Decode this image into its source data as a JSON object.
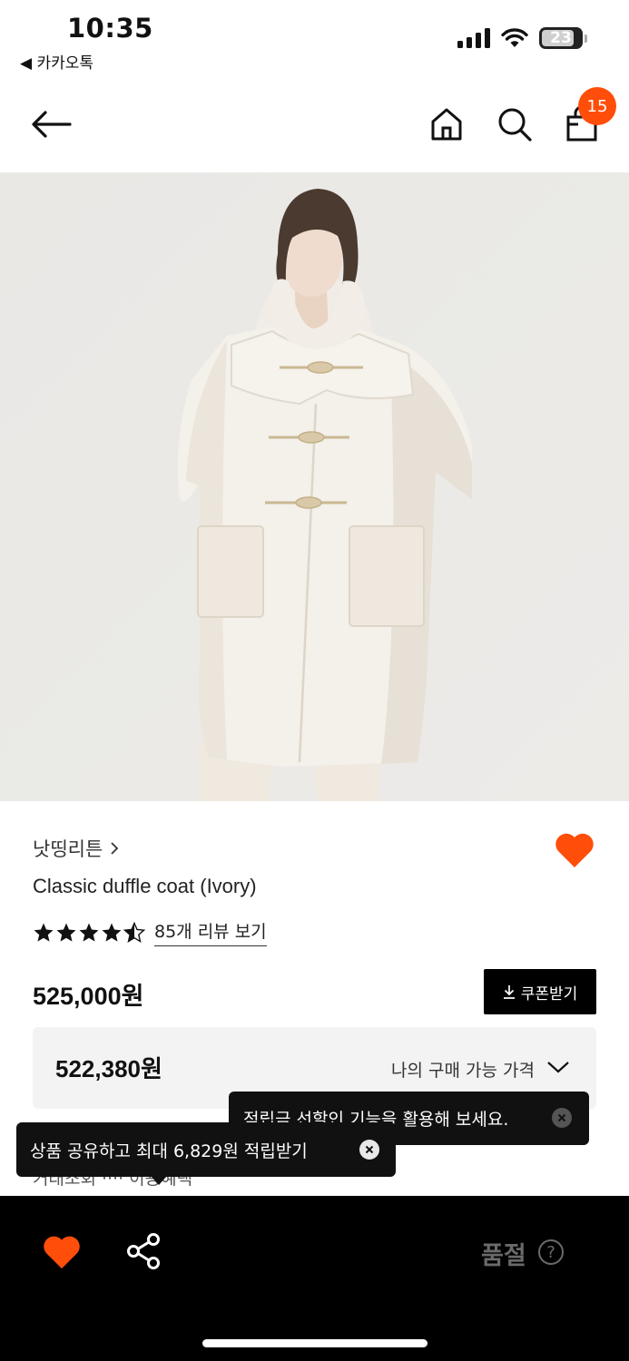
{
  "status": {
    "time": "10:35",
    "back_app": "◀ 카카오톡",
    "battery": "23"
  },
  "nav": {
    "cart_count": "15"
  },
  "product": {
    "brand": "낫띵리튼",
    "name": "Classic duffle coat (Ivory)",
    "rating": 4.5,
    "review_link": "85개 리뷰 보기",
    "price": "525,000원",
    "coupon_label": "쿠폰받기",
    "my_price": "522,380원",
    "my_price_label": "나의 구매 가능 가격",
    "hidden_row": "거래조회 ···· 이용혜택"
  },
  "tooltips": {
    "points": "적립금 선할인 기능을 활용해 보세요.",
    "share": "상품 공유하고 최대 6,829원 적립받기"
  },
  "bottom_bar": {
    "soldout_label": "품절",
    "help_label": "?"
  },
  "colors": {
    "accent": "#ff4e0a",
    "badge": "#ff4e0a",
    "bar": "#000000"
  },
  "icons": [
    "back-arrow-icon",
    "home-icon",
    "search-icon",
    "cart-icon",
    "heart-icon",
    "share-icon",
    "download-icon",
    "chevron-down-icon",
    "close-icon",
    "help-icon"
  ]
}
